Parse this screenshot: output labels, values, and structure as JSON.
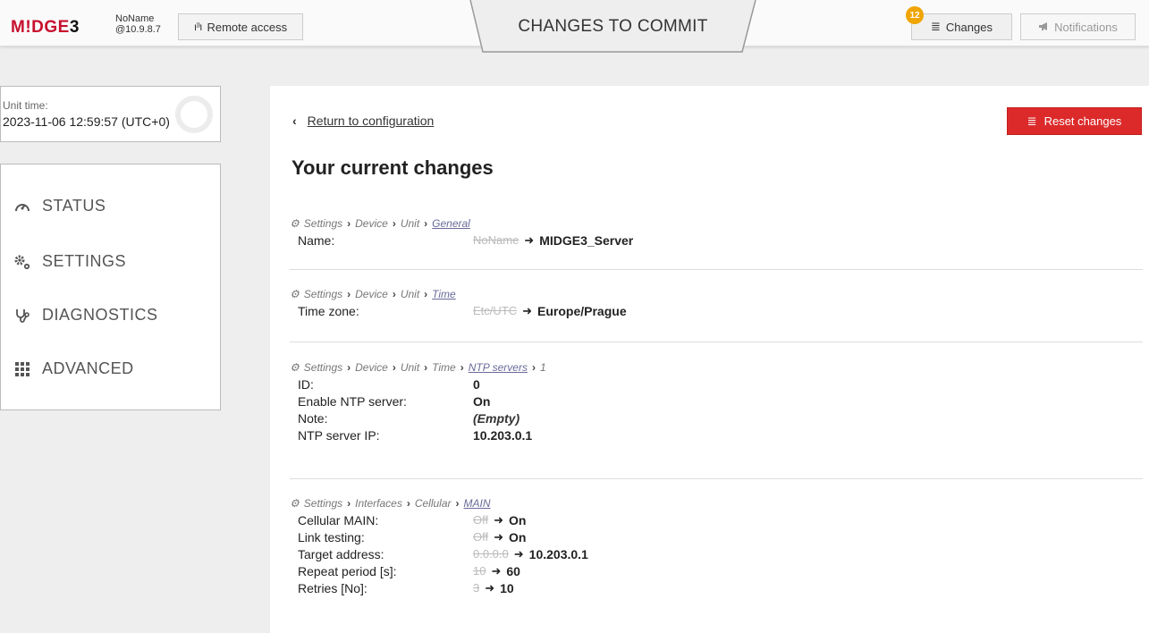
{
  "header": {
    "logo_main": "M!DGE",
    "logo_num": "3",
    "unit_name": "NoName",
    "unit_ip": "@10.9.8.7",
    "remote_access_label": "Remote access",
    "banner_title": "CHANGES TO COMMIT",
    "changes_label": "Changes",
    "changes_count": "12",
    "notifications_label": "Notifications"
  },
  "unit_time": {
    "label": "Unit time:",
    "value": "2023-11-06 12:59:57 (UTC+0)"
  },
  "nav": {
    "items": [
      {
        "label": "STATUS",
        "icon": "gauge-icon"
      },
      {
        "label": "SETTINGS",
        "icon": "gears-icon"
      },
      {
        "label": "DIAGNOSTICS",
        "icon": "stethoscope-icon"
      },
      {
        "label": "ADVANCED",
        "icon": "grid-icon"
      }
    ]
  },
  "main": {
    "back_label": "Return to configuration",
    "reset_label": "Reset changes",
    "title": "Your current changes",
    "groups": [
      {
        "crumbs": [
          "Settings",
          "Device",
          "Unit"
        ],
        "link": "General",
        "rows": [
          {
            "key": "Name:",
            "old": "NoName",
            "new": "MIDGE3_Server"
          }
        ]
      },
      {
        "crumbs": [
          "Settings",
          "Device",
          "Unit"
        ],
        "link": "Time",
        "rows": [
          {
            "key": "Time zone:",
            "old": "Etc/UTC",
            "new": "Europe/Prague"
          }
        ]
      },
      {
        "crumbs": [
          "Settings",
          "Device",
          "Unit",
          "Time"
        ],
        "link": "NTP servers",
        "suffix": "1",
        "rows": [
          {
            "key": "ID:",
            "new": "0"
          },
          {
            "key": "Enable NTP server:",
            "new": "On"
          },
          {
            "key": "Note:",
            "empty": "(Empty)"
          },
          {
            "key": "NTP server IP:",
            "new": "10.203.0.1"
          }
        ]
      },
      {
        "crumbs": [
          "Settings",
          "Interfaces",
          "Cellular"
        ],
        "link": "MAIN",
        "rows": [
          {
            "key": "Cellular MAIN:",
            "old": "Off",
            "new": "On"
          },
          {
            "key": "Link testing:",
            "old": "Off",
            "new": "On"
          },
          {
            "key": "Target address:",
            "old": "0.0.0.0",
            "new": "10.203.0.1"
          },
          {
            "key": "Repeat period [s]:",
            "old": "10",
            "new": "60"
          },
          {
            "key": "Retries [No]:",
            "old": "3",
            "new": "10"
          }
        ]
      }
    ]
  },
  "colors": {
    "brand_red": "#c8102e",
    "reset_red": "#dc2a2a",
    "badge_orange": "#f0a500"
  }
}
